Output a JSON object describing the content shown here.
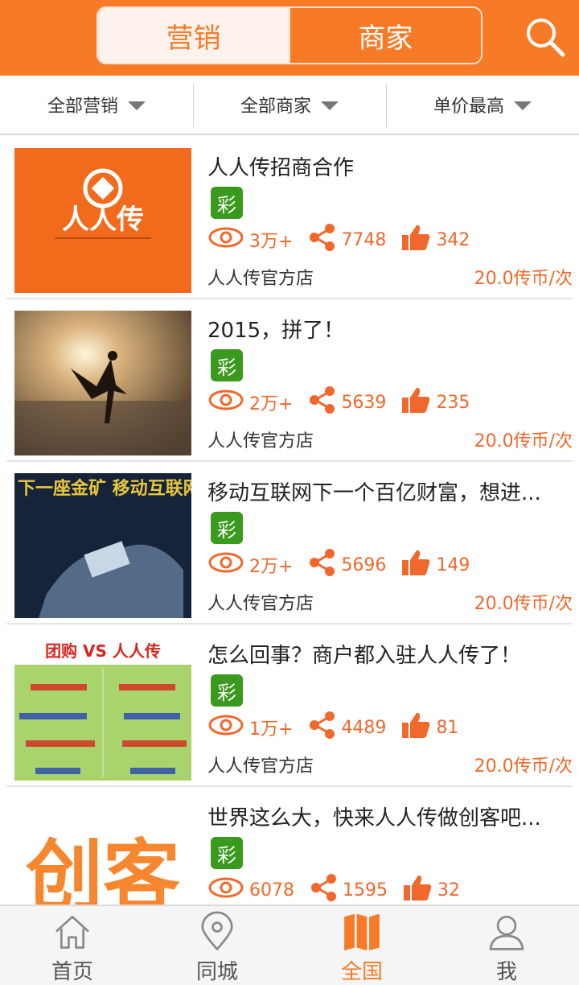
{
  "header": {
    "tabs": [
      {
        "label": "营销",
        "active": true
      },
      {
        "label": "商家",
        "active": false
      }
    ],
    "search_icon": "search-icon",
    "accent_color": "#f77a27"
  },
  "filters": [
    {
      "label": "全部营销"
    },
    {
      "label": "全部商家"
    },
    {
      "label": "单价最高"
    }
  ],
  "items": [
    {
      "title": "人人传招商合作",
      "badge": "彩",
      "views": "3万+",
      "shares": "7748",
      "likes": "342",
      "shop": "人人传官方店",
      "price": "20.0传币/次",
      "thumb_text": "人人传"
    },
    {
      "title": "2015，拼了！",
      "badge": "彩",
      "views": "2万+",
      "shares": "5639",
      "likes": "235",
      "shop": "人人传官方店",
      "price": "20.0传币/次"
    },
    {
      "title": "移动互联网下一个百亿财富，想进...",
      "badge": "彩",
      "views": "2万+",
      "shares": "5696",
      "likes": "149",
      "shop": "人人传官方店",
      "price": "20.0传币/次",
      "thumb_text": "下一座金矿 移动互联网"
    },
    {
      "title": "怎么回事？商户都入驻人人传了！",
      "badge": "彩",
      "views": "1万+",
      "shares": "4489",
      "likes": "81",
      "shop": "人人传官方店",
      "price": "20.0传币/次",
      "thumb_text": "团购 VS 人人传"
    },
    {
      "title": "世界这么大，快来人人传做创客吧...",
      "badge": "彩",
      "views": "6078",
      "shares": "1595",
      "likes": "32",
      "shop": "",
      "price": "",
      "thumb_text": "创客"
    }
  ],
  "nav": [
    {
      "label": "首页",
      "icon": "home-icon",
      "active": false
    },
    {
      "label": "同城",
      "icon": "location-pin-icon",
      "active": false
    },
    {
      "label": "全国",
      "icon": "map-icon",
      "active": true
    },
    {
      "label": "我",
      "icon": "user-icon",
      "active": false
    }
  ]
}
